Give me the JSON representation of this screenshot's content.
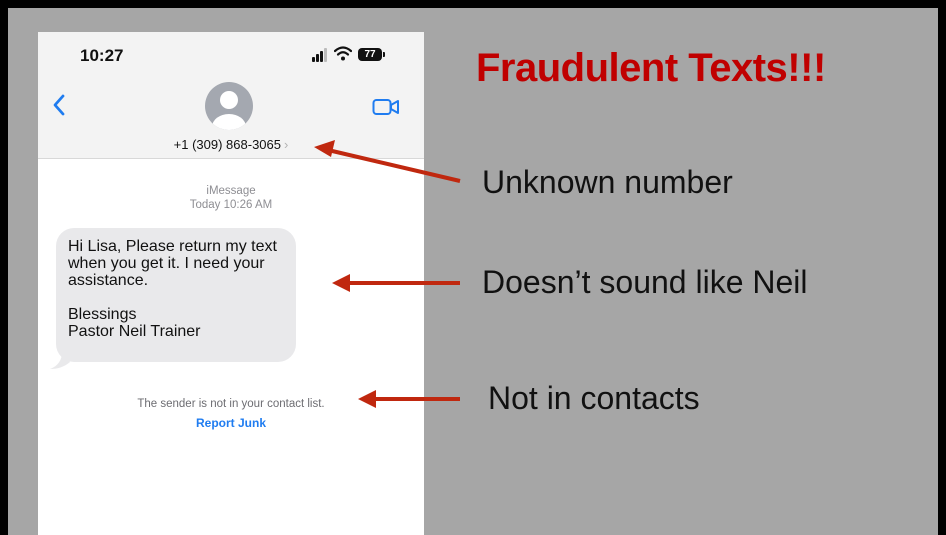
{
  "status_bar": {
    "time": "10:27",
    "battery": "77"
  },
  "contact": {
    "number": "+1 (309) 868-3065",
    "chevron": "›"
  },
  "conversation": {
    "service": "iMessage",
    "timestamp": "Today 10:26 AM",
    "message": "Hi Lisa, Please return my text\nwhen you get it. I need your\nassistance.\n\nBlessings\nPastor Neil Trainer",
    "notice": "The sender is not in your contact list.",
    "report_junk_label": "Report Junk"
  },
  "annotations": {
    "title": "Fraudulent Texts!!!",
    "callouts": [
      "Unknown number",
      "Doesn’t sound like Neil",
      "Not in contacts"
    ]
  },
  "colors": {
    "title": "#c00000",
    "arrow": "#c0280f",
    "ios_blue": "#1f7cf0",
    "slide_background": "#a6a6a6",
    "bubble": "#e9e9eb"
  },
  "icons": {
    "back": "chevron-left-icon",
    "video": "video-camera-icon",
    "avatar": "person-silhouette-icon",
    "signal": "cellular-signal-icon",
    "wifi": "wifi-icon",
    "battery": "battery-icon"
  }
}
